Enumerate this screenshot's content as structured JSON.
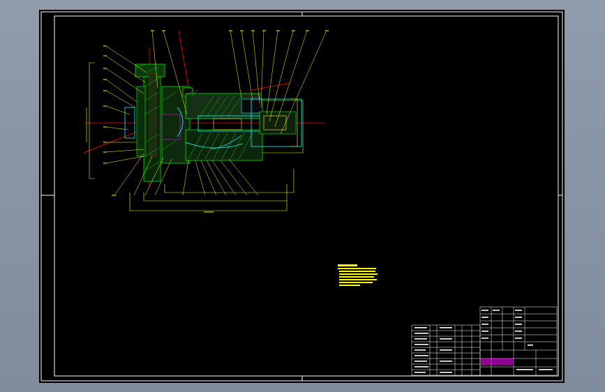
{
  "viewport": {
    "background": "#8a97a7",
    "sheet_background": "#000000"
  },
  "colors": {
    "frame": "#ffffff",
    "leader_lines": "#ffff00",
    "center_lines": "#ff0000",
    "part_outline": "#00ffff",
    "hatch": "#00ff00",
    "note_text": "#ffff00",
    "title_block": "#ffffff",
    "title_highlight": "#ff00ff"
  },
  "drawing": {
    "type": "assembly-section-drawing",
    "note_text": "",
    "title_block_text": ""
  }
}
